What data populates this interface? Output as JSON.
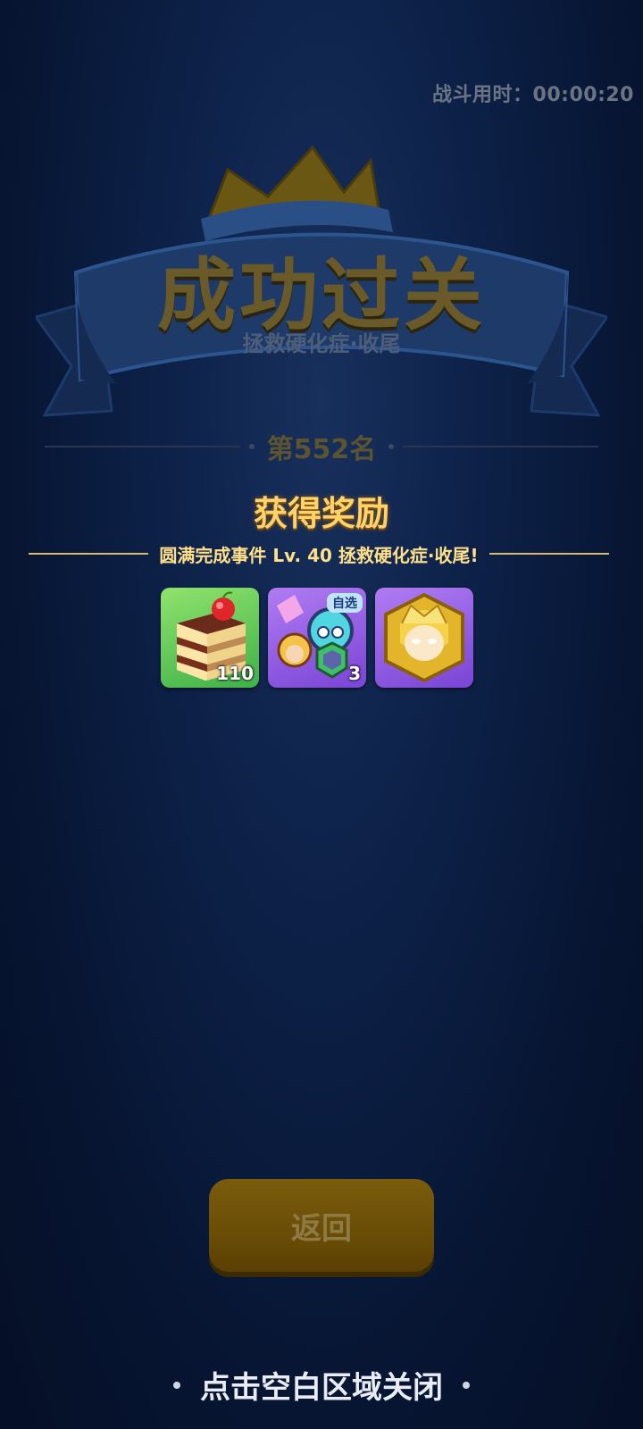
{
  "header": {
    "timer_label": "战斗用时：",
    "timer_value": "00:00:20"
  },
  "banner": {
    "title": "成功过关",
    "subtitle": "拯救硬化症·收尾"
  },
  "rank": {
    "text": "第552名"
  },
  "reward": {
    "title": "获得奖励",
    "description": "圆满完成事件 Lv. 40 拯救硬化症·收尾!",
    "items": [
      {
        "icon": "cake-icon",
        "count": "110",
        "tag": ""
      },
      {
        "icon": "hero-selection-pack-icon",
        "count": "3",
        "tag": "自选"
      },
      {
        "icon": "golden-hero-avatar-icon",
        "count": "",
        "tag": ""
      }
    ]
  },
  "actions": {
    "return_label": "返回",
    "close_hint": "点击空白区域关闭"
  },
  "colors": {
    "background": "#0b1a3c",
    "accent_gold": "#ffd36a",
    "button": "#6a4d06"
  }
}
